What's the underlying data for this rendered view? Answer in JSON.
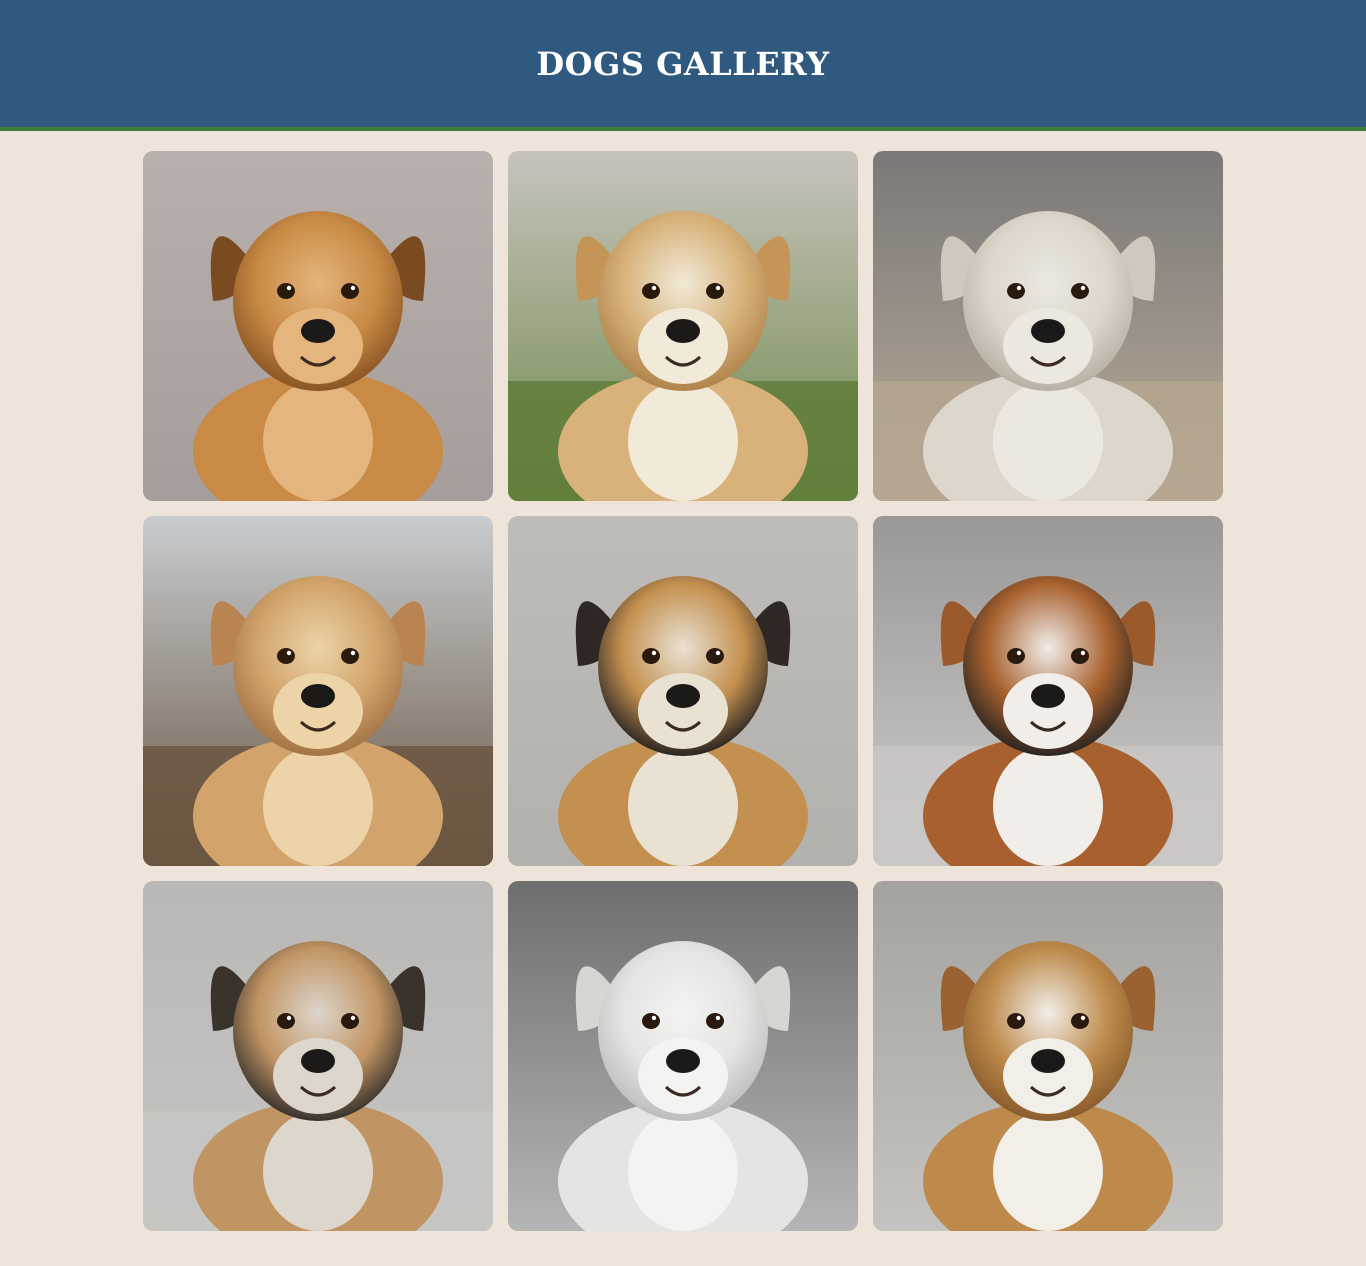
{
  "header": {
    "title": "DOGS GALLERY"
  },
  "colors": {
    "header_bg": "#30597f",
    "header_border": "#3f7e3a",
    "page_bg": "#efe4da"
  },
  "gallery": {
    "items": [
      {
        "name": "golden-dog-portrait",
        "icon": "dog-photo",
        "bg_top": "#b8b0ad",
        "bg_bottom": "#a59d9b",
        "ground": null,
        "fur": "#c98a45",
        "fur_dark": "#8a5524",
        "ear": "#7a4a20",
        "chest": "#e4b57c"
      },
      {
        "name": "cream-dog-lying-on-grass",
        "icon": "dog-photo",
        "bg_top": "#c7c3bd",
        "bg_bottom": "#6f8a4a",
        "ground": "#5f7d3a",
        "fur": "#d8b27a",
        "fur_dark": "#b0834c",
        "ear": "#c49556",
        "chest": "#f1ead8"
      },
      {
        "name": "white-dog-sitting",
        "icon": "dog-photo",
        "bg_top": "#7b7878",
        "bg_bottom": "#b9ab97",
        "ground": "#b4a68f",
        "fur": "#dcd6cb",
        "fur_dark": "#b8b0a3",
        "ear": "#cfc8bc",
        "chest": "#ece8e0"
      },
      {
        "name": "shepherd-mix-lying-in-field",
        "icon": "dog-photo",
        "bg_top": "#c8ccd0",
        "bg_bottom": "#6a5541",
        "ground": "#6b5641",
        "fur": "#d2a46c",
        "fur_dark": "#a37445",
        "ear": "#b98450",
        "chest": "#ecd3a8"
      },
      {
        "name": "black-and-tan-dog-portrait",
        "icon": "dog-photo",
        "bg_top": "#bebcb8",
        "bg_bottom": "#b3b1ad",
        "ground": null,
        "fur": "#c4904f",
        "fur_dark": "#2a2522",
        "ear": "#2e2723",
        "chest": "#e9e2d3"
      },
      {
        "name": "tricolor-collie-lying",
        "icon": "dog-photo",
        "bg_top": "#9a9897",
        "bg_bottom": "#cfcdcb",
        "ground": "#c9c7c5",
        "fur": "#a8612e",
        "fur_dark": "#2b2521",
        "ear": "#9a5a2c",
        "chest": "#f1eeea"
      },
      {
        "name": "german-shepherd-standing",
        "icon": "dog-photo",
        "bg_top": "#b9b8b6",
        "bg_bottom": "#c6c5c3",
        "ground": "#c6c5c3",
        "fur": "#c19463",
        "fur_dark": "#37322d",
        "ear": "#3a332c",
        "chest": "#ddd6cc"
      },
      {
        "name": "white-dog-with-collar",
        "icon": "dog-photo",
        "bg_top": "#6e6e6e",
        "bg_bottom": "#b5b5b5",
        "ground": null,
        "fur": "#e4e4e2",
        "fur_dark": "#bdbdbb",
        "ear": "#d8d6d3",
        "chest": "#f3f3f1"
      },
      {
        "name": "tan-dog-portrait",
        "icon": "dog-photo",
        "bg_top": "#a4a3a0",
        "bg_bottom": "#c4c3c0",
        "ground": null,
        "fur": "#bd8a4b",
        "fur_dark": "#8a5c2c",
        "ear": "#9a6231",
        "chest": "#f2eee8"
      }
    ]
  }
}
